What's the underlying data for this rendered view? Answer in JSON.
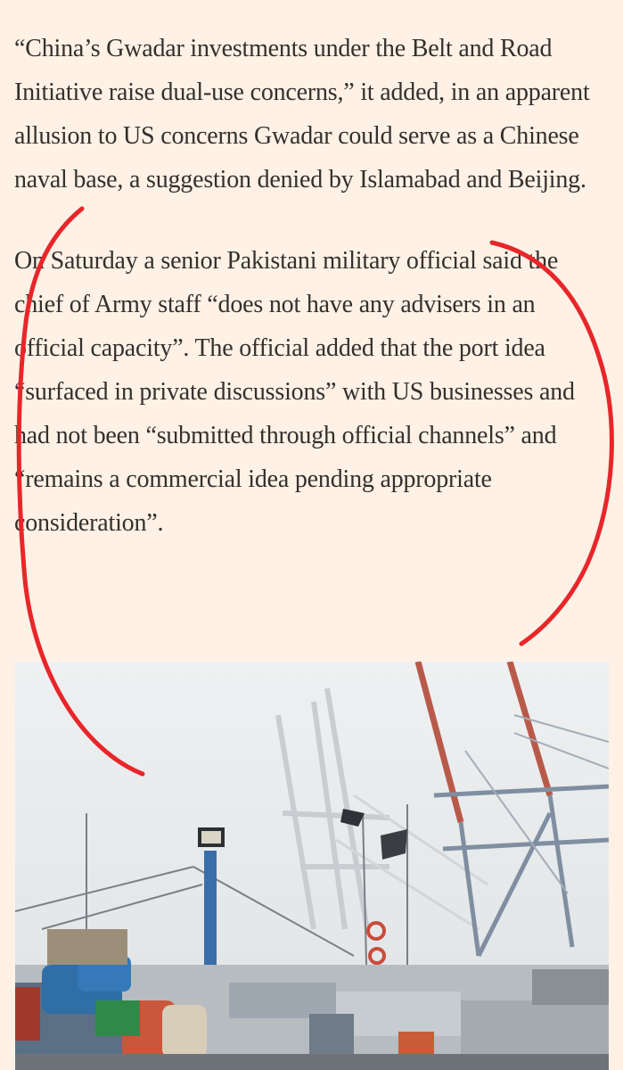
{
  "article": {
    "paragraphs": [
      "“China’s Gwadar investments under the Belt and Road Initiative raise dual-use concerns,” it added, in an apparent allusion to US concerns Gwadar could serve as a Chinese naval base, a suggestion denied by Islamabad and Beijing.",
      "On Saturday a senior Pakistani military official said the chief of Army staff “does not have any advisers in an official capacity”. The official added that the port idea “surfaced in private discussions” with US businesses and had not been “submitted through official channels” and “remains a commercial idea pending appropriate consideration”."
    ]
  },
  "colors": {
    "page_background": "#fff1e5",
    "text": "#33302e",
    "annotation_stroke": "#e8262a"
  },
  "photo": {
    "icon": "harbor-photo"
  }
}
